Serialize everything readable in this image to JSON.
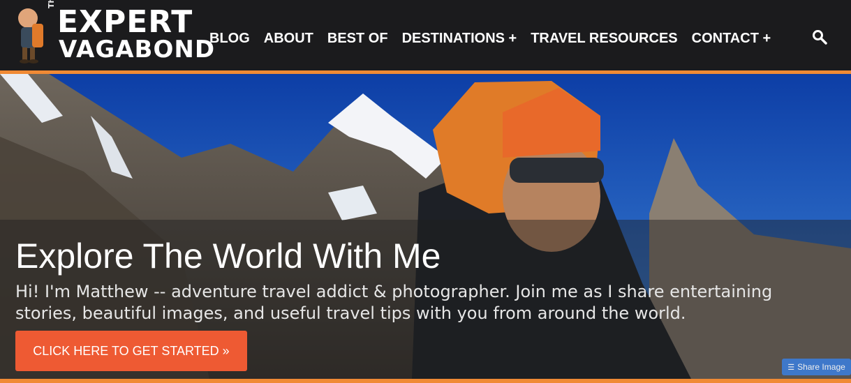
{
  "logo": {
    "the": "The",
    "line1": "EXPERT",
    "line2": "VAGABOND"
  },
  "nav": {
    "items": [
      {
        "label": "BLOG"
      },
      {
        "label": "ABOUT"
      },
      {
        "label": "BEST OF"
      },
      {
        "label": "DESTINATIONS +"
      },
      {
        "label": "TRAVEL RESOURCES"
      },
      {
        "label": "CONTACT +"
      }
    ],
    "search_icon": "search-icon"
  },
  "hero": {
    "headline": "Explore The World With Me",
    "subtext": "Hi! I'm Matthew -- adventure travel addict & photographer. Join me as I share entertaining stories, beautiful images, and useful travel tips with you from around the world.",
    "cta_label": "CLICK HERE TO GET STARTED »",
    "share_label": "Share Image"
  },
  "colors": {
    "accent": "#f08a35",
    "cta": "#ee5a33",
    "header_bg": "#1b1b1d",
    "share": "#3b7dd8"
  }
}
